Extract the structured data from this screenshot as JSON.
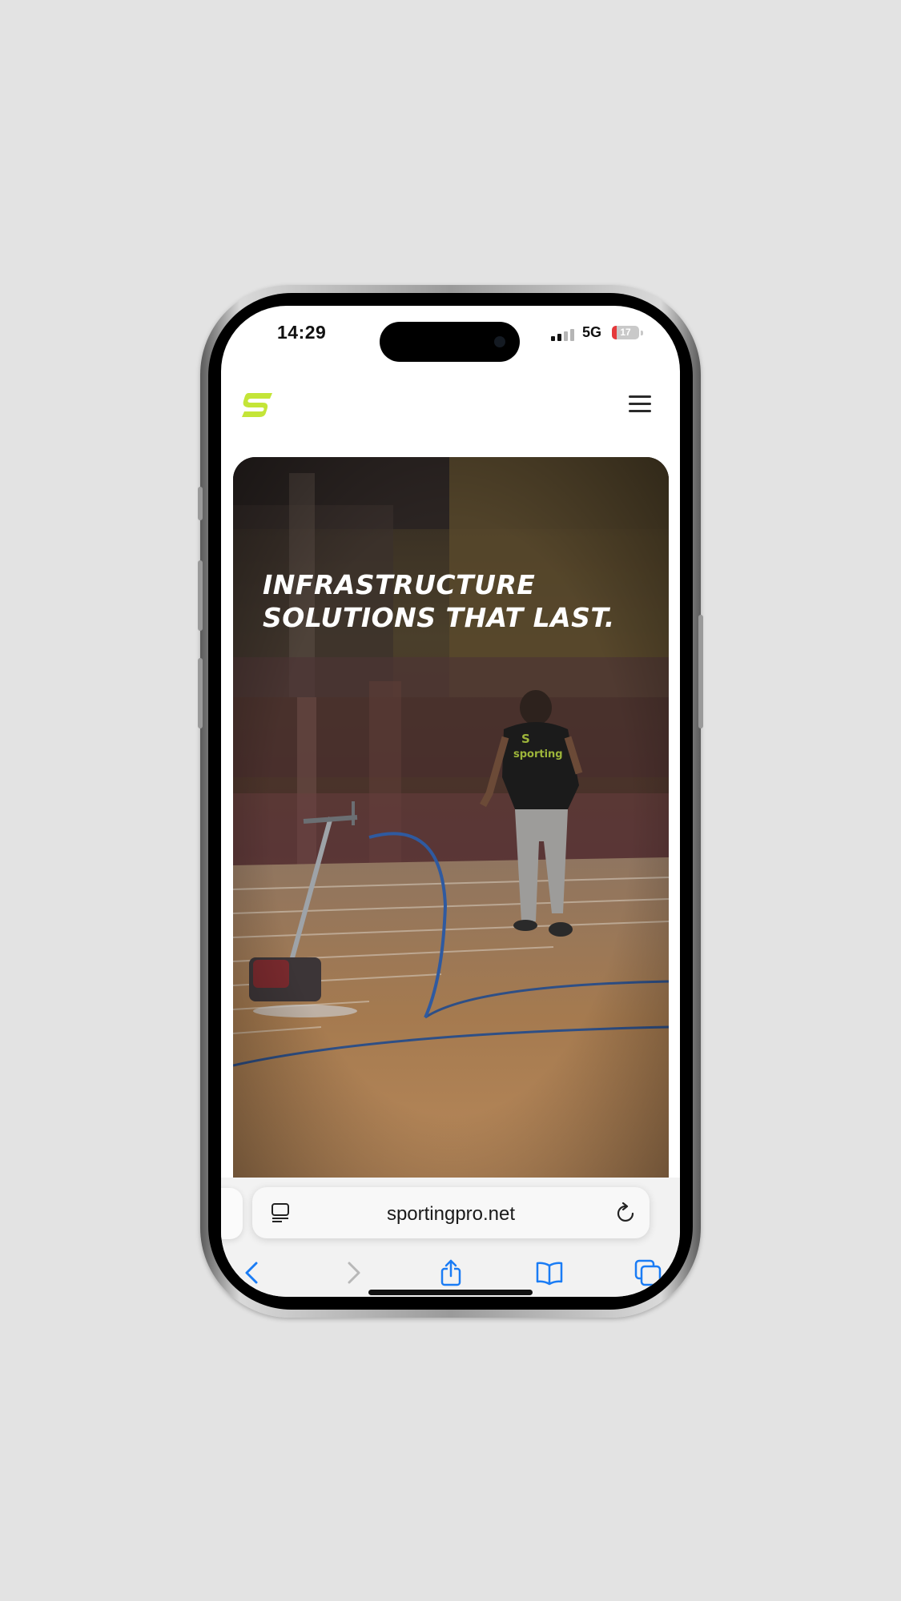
{
  "status_bar": {
    "time": "14:29",
    "network": "5G",
    "battery_level": "17"
  },
  "site": {
    "logo_icon": "sportingpro-s-logo-icon",
    "accent_color": "#c4e538",
    "menu_icon": "hamburger-menu-icon"
  },
  "hero": {
    "headline": "INFRASTRUCTURE SOLUTIONS THAT LAST."
  },
  "browser": {
    "url": "sportingpro.net",
    "buttons": {
      "reader": "reader-mode-icon",
      "reload": "reload-icon",
      "back": "back-chevron-icon",
      "forward": "forward-chevron-icon",
      "share": "share-icon",
      "bookmarks": "bookmarks-icon",
      "tabs": "tabs-icon"
    },
    "accent_color": "#1a7cf5"
  }
}
